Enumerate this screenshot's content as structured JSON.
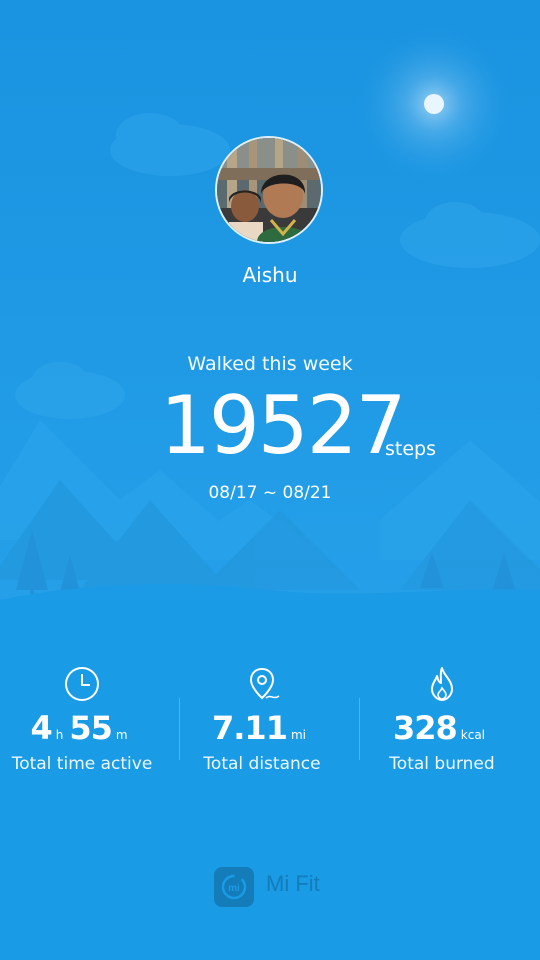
{
  "profile": {
    "username": "Aishu"
  },
  "summary": {
    "label": "Walked this week",
    "steps": "19527",
    "unit": "steps",
    "date_range": "08/17 ~ 08/21"
  },
  "stats": {
    "time": {
      "hours": "4",
      "hours_unit": "h",
      "minutes": "55",
      "minutes_unit": "m",
      "label": "Total time active"
    },
    "distance": {
      "value": "7.11",
      "unit": "mi",
      "label": "Total distance"
    },
    "burned": {
      "value": "328",
      "unit": "kcal",
      "label": "Total burned"
    }
  },
  "brand": {
    "name": "Mi Fit"
  },
  "icons": {
    "time": "clock-icon",
    "distance": "location-pin-icon",
    "burned": "flame-icon",
    "logo": "mi-fit-logo-icon"
  },
  "colors": {
    "background": "#1a9be6",
    "hill_light": "#2aa7ec",
    "hill_dark": "#1e92d8",
    "brand": "#137cb9"
  }
}
